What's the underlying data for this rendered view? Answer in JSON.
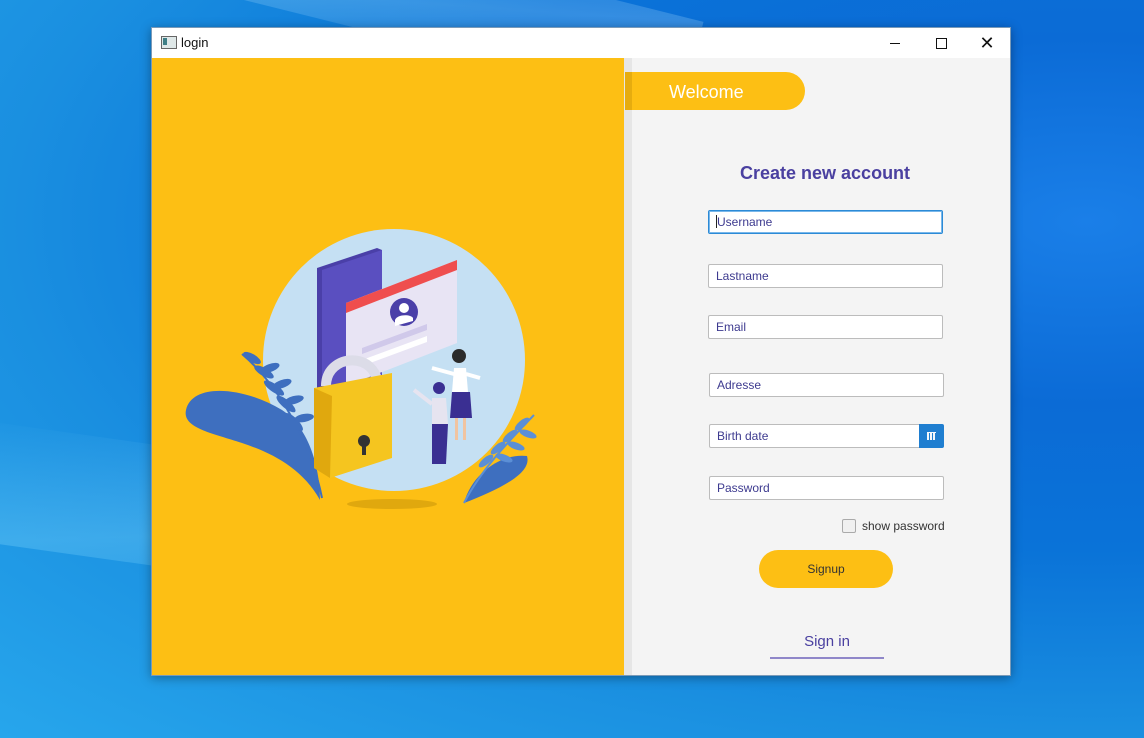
{
  "window": {
    "title": "login"
  },
  "welcome_tab": {
    "label": "Welcome"
  },
  "form": {
    "heading": "Create new account",
    "fields": {
      "username": {
        "placeholder": "Username",
        "value": ""
      },
      "lastname": {
        "placeholder": "Lastname",
        "value": ""
      },
      "email": {
        "placeholder": "Email",
        "value": ""
      },
      "address": {
        "placeholder": "Adresse",
        "value": ""
      },
      "birth_date": {
        "placeholder": "Birth date",
        "value": ""
      },
      "password": {
        "placeholder": "Password",
        "value": ""
      }
    },
    "show_password": {
      "label": "show password",
      "checked": false
    },
    "signup_label": "Signup",
    "signin_label": "Sign in"
  },
  "colors": {
    "accent_yellow": "#fdbf14",
    "heading_purple": "#4a40a0",
    "calendar_blue": "#1f7ed0"
  },
  "icons": {
    "app": "window-icon",
    "minimize": "minimize-icon",
    "maximize": "maximize-icon",
    "close": "close-icon",
    "calendar": "calendar-icon",
    "illustration": "security-lock-illustration"
  }
}
